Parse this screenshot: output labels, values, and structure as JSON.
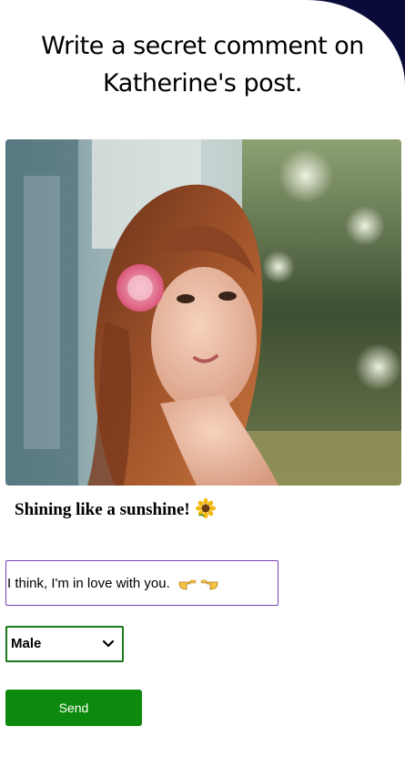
{
  "header": {
    "line1": "Write a secret comment on",
    "line2": "Katherine's post."
  },
  "post": {
    "caption": "Shining like a sunshine!",
    "caption_icon": "sunflower-icon"
  },
  "comment": {
    "value": "I think, I'm in love with you.",
    "emoji_icon": "pointing-hands-icon",
    "border_color": "#7a3fb8"
  },
  "gender": {
    "selected": "Male",
    "border_color": "#1a7a1a"
  },
  "send": {
    "label": "Send",
    "color": "#0d8a0d"
  }
}
